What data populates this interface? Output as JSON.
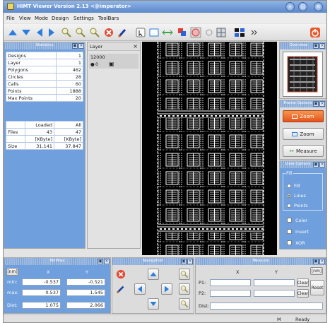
{
  "window": {
    "title": "HIMT Viewer   Version 2.13 <@imperator>"
  },
  "menu": [
    "File",
    "View",
    "Mode",
    "Design",
    "Settings",
    "ToolBars"
  ],
  "toolbar": {
    "icons": [
      "triangle-up-icon",
      "triangle-down-icon",
      "triangle-left-icon",
      "triangle-right-icon",
      "zoom-in-icon",
      "zoom-out-icon",
      "zoom-fit-icon",
      "stop-icon",
      "draw-icon",
      "select-icon",
      "rectangle-icon",
      "measure-icon",
      "layers-icon",
      "circle-icon",
      "polygon-icon",
      "grid-icon",
      "more-icon",
      "exit-icon"
    ]
  },
  "statistics": {
    "title": "Statistics",
    "rows": [
      {
        "label": "Designs",
        "value": "1"
      },
      {
        "label": "Layer",
        "value": "1"
      },
      {
        "label": "Polygons",
        "value": "462"
      },
      {
        "label": "Circles",
        "value": "28"
      },
      {
        "label": "Calls",
        "value": "60"
      },
      {
        "label": "Points",
        "value": "1888"
      },
      {
        "label": "Max Points",
        "value": "20"
      }
    ],
    "files": {
      "header": [
        "",
        "Loaded",
        "All"
      ],
      "rows": [
        [
          "Files",
          "43",
          "47"
        ],
        [
          "",
          "[KByte]",
          "[KByte]"
        ],
        [
          "Size",
          "31.141",
          "37.847"
        ]
      ]
    }
  },
  "layer": {
    "title": "Layer",
    "items": [
      {
        "name": "12000",
        "sub": "0"
      }
    ]
  },
  "overview": {
    "title": "Overview"
  },
  "frame_options": {
    "title": "Frame Options",
    "zoom_primary": "Zoom",
    "zoom_secondary": "Zoom",
    "measure": "Measure"
  },
  "view_options": {
    "title": "View Options",
    "fill_group": "Fill",
    "radios": [
      {
        "label": "Fill",
        "selected": false
      },
      {
        "label": "Lines",
        "selected": true
      },
      {
        "label": "Points",
        "selected": false
      }
    ],
    "checks": [
      {
        "label": "Color",
        "checked": false
      },
      {
        "label": "Invert",
        "checked": false
      },
      {
        "label": "XOR",
        "checked": false
      }
    ]
  },
  "minmax": {
    "title": "MinMax",
    "unit": "[nm]",
    "col_x": "X",
    "col_y": "Y",
    "min_label": "min:",
    "min_x": "-0.537",
    "min_y": "-0.521",
    "max_label": "max:",
    "max_x": "0.537",
    "max_y": "1.545",
    "dist_label": "Dist:",
    "dist_x": "1.075",
    "dist_y": "2.066"
  },
  "navigation": {
    "title": "Navigation"
  },
  "measure": {
    "title": "Measure",
    "col_x": "X",
    "col_y": "Y",
    "unit": "[nm]",
    "p1_label": "P1:",
    "p2_label": "P2:",
    "dist_label": "Dist:",
    "clear1": "Clear",
    "clear2": "Clear",
    "reset": "Reset"
  },
  "status": {
    "mode": "M",
    "text": "Ready"
  }
}
